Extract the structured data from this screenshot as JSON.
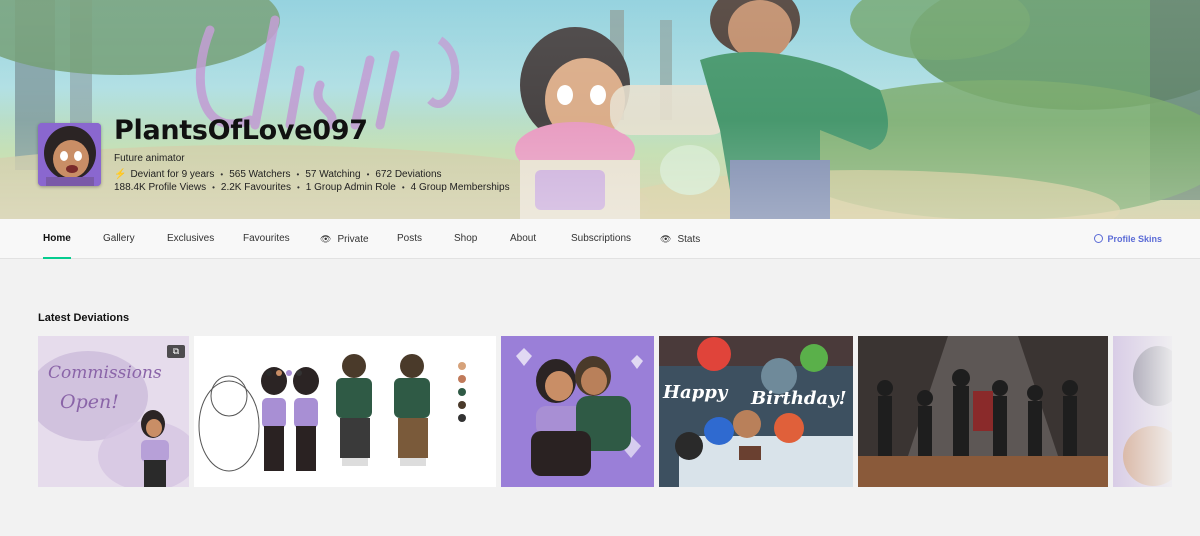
{
  "profile": {
    "username": "PlantsOfLove097",
    "tagline": "Future animator",
    "stats_row1": [
      "Deviant for 9 years",
      "565 Watchers",
      "57 Watching",
      "672 Deviations"
    ],
    "stats_row2": [
      "188.4K Profile Views",
      "2.2K Favourites",
      "1 Group Admin Role",
      "4 Group Memberships"
    ],
    "banner_signature": "Christi"
  },
  "nav": {
    "items": [
      "Home",
      "Gallery",
      "Exclusives",
      "Favourites",
      "Private",
      "Posts",
      "Shop",
      "About",
      "Subscriptions",
      "Stats"
    ],
    "active": "Home",
    "profile_skins": "Profile Skins"
  },
  "section": {
    "title": "Latest Deviations"
  },
  "deviations": [
    {
      "text_lines": [
        "Commissions",
        "Open!"
      ],
      "icon": "multi-image-icon"
    },
    {
      "text_lines": []
    },
    {
      "text_lines": []
    },
    {
      "text_lines": [
        "Happy",
        "Birthday!"
      ]
    },
    {
      "text_lines": []
    },
    {
      "text_lines": []
    }
  ],
  "colors": {
    "accent_green": "#05cc8f",
    "skins_blue": "#5b6bd6",
    "page_bg": "#f2f2f2"
  }
}
